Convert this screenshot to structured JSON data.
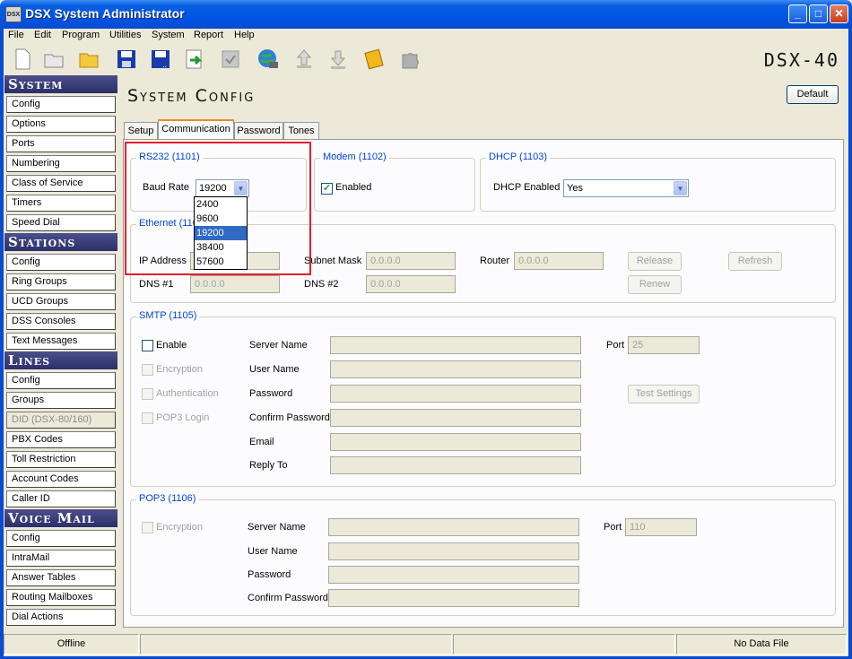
{
  "window": {
    "title": "DSX System Administrator",
    "app_icon": "DSX"
  },
  "menu": [
    "File",
    "Edit",
    "Program",
    "Utilities",
    "System",
    "Report",
    "Help"
  ],
  "brand": "DSX-40",
  "sidebar": {
    "system_header": "System",
    "system_items": [
      "Config",
      "Options",
      "Ports",
      "Numbering",
      "Class of Service",
      "Timers",
      "Speed Dial"
    ],
    "stations_header": "Stations",
    "stations_items": [
      "Config",
      "Ring Groups",
      "UCD Groups",
      "DSS Consoles",
      "Text Messages"
    ],
    "lines_header": "Lines",
    "lines_items": [
      "Config",
      "Groups",
      "DID (DSX-80/160)",
      "PBX Codes",
      "Toll Restriction",
      "Account Codes",
      "Caller ID"
    ],
    "voicemail_header": "Voice Mail",
    "voicemail_items": [
      "Config",
      "IntraMail",
      "Answer Tables",
      "Routing Mailboxes",
      "Dial Actions"
    ]
  },
  "page": {
    "title": "System Config",
    "default_button": "Default"
  },
  "tabs": [
    "Setup",
    "Communication",
    "Password",
    "Tones"
  ],
  "rs232": {
    "title": "RS232 (1101)",
    "baud_label": "Baud Rate",
    "baud_value": "19200",
    "baud_options": [
      "2400",
      "9600",
      "19200",
      "38400",
      "57600"
    ]
  },
  "modem": {
    "title": "Modem (1102)",
    "enabled_label": "Enabled"
  },
  "dhcp": {
    "title": "DHCP (1103)",
    "label": "DHCP Enabled",
    "value": "Yes"
  },
  "ethernet": {
    "title": "Ethernet (1104)",
    "ip_label": "IP Address",
    "ip_value": "0.0.0.0",
    "subnet_label": "Subnet Mask",
    "subnet_value": "0.0.0.0",
    "router_label": "Router",
    "router_value": "0.0.0.0",
    "dns1_label": "DNS #1",
    "dns1_value": "0.0.0.0",
    "dns2_label": "DNS #2",
    "dns2_value": "0.0.0.0",
    "release_button": "Release",
    "refresh_button": "Refresh",
    "renew_button": "Renew"
  },
  "smtp": {
    "title": "SMTP (1105)",
    "enable_label": "Enable",
    "encryption_label": "Encryption",
    "authentication_label": "Authentication",
    "pop3_login_label": "POP3 Login",
    "server_label": "Server Name",
    "user_label": "User Name",
    "password_label": "Password",
    "confirm_label": "Confirm Password",
    "email_label": "Email",
    "reply_label": "Reply To",
    "port_label": "Port",
    "port_value": "25",
    "test_button": "Test Settings"
  },
  "pop3": {
    "title": "POP3 (1106)",
    "encryption_label": "Encryption",
    "server_label": "Server Name",
    "user_label": "User Name",
    "password_label": "Password",
    "confirm_label": "Confirm Password",
    "port_label": "Port",
    "port_value": "110"
  },
  "status": {
    "left": "Offline",
    "right": "No Data File"
  }
}
